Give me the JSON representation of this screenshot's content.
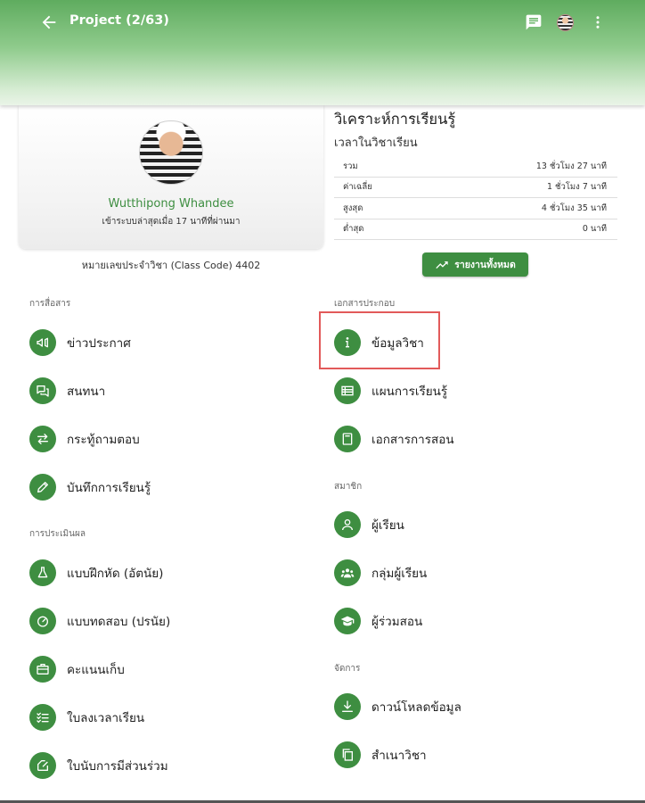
{
  "app_bar": {
    "title": "Project (2/63)",
    "back_icon": "arrow-left-icon",
    "chat_icon": "chat-icon",
    "more_icon": "more-vert-icon"
  },
  "profile": {
    "name": "Wutthipong Whandee",
    "last_login": "เข้าระบบล่าสุดเมื่อ 17 นาทีที่ผ่านมา",
    "class_code": "หมายเลขประจำวิชา (Class Code) 4402"
  },
  "analytics": {
    "title": "วิเคราะห์การเรียนรู้",
    "subtitle": "เวลาในวิชาเรียน",
    "rows": [
      {
        "label": "รวม",
        "value": "13 ชั่วโมง 27 นาที"
      },
      {
        "label": "ค่าเฉลี่ย",
        "value": "1 ชั่วโมง 7 นาที"
      },
      {
        "label": "สูงสุด",
        "value": "4 ชั่วโมง 35 นาที"
      },
      {
        "label": "ต่ำสุด",
        "value": "0 นาที"
      }
    ],
    "report_button": "รายงานทั้งหมด"
  },
  "sections": {
    "communication": "การสื่อสาร",
    "assessment": "การประเมินผล",
    "documents": "เอกสารประกอบ",
    "members": "สมาชิก",
    "manage": "จัดการ"
  },
  "menu": {
    "announcements": "ข่าวประกาศ",
    "discussion": "สนทนา",
    "qa": "กระทู้ถามตอบ",
    "journal": "บันทึกการเรียนรู้",
    "exercises": "แบบฝึกหัด (อัตนัย)",
    "quizzes": "แบบทดสอบ (ปรนัย)",
    "scores": "คะแนนเก็บ",
    "attendance": "ใบลงเวลาเรียน",
    "participation": "ใบนับการมีส่วนร่วม",
    "course_info": "ข้อมูลวิชา",
    "lesson_plan": "แผนการเรียนรู้",
    "teaching_docs": "เอกสารการสอน",
    "students": "ผู้เรียน",
    "student_groups": "กลุ่มผู้เรียน",
    "co_teachers": "ผู้ร่วมสอน",
    "download": "ดาวน์โหลดข้อมูล",
    "copy_course": "สำเนาวิชา"
  },
  "colors": {
    "primary": "#3e8e41",
    "appbar_top": "#5fac5f",
    "highlight": "#e25a5a"
  }
}
